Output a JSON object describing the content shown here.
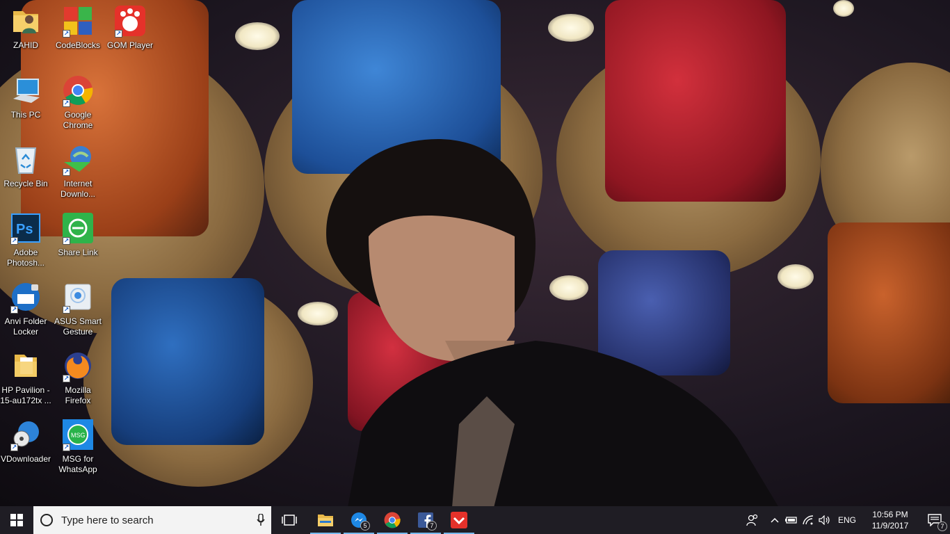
{
  "desktop": {
    "icons": [
      {
        "label": "ZAHID",
        "icon": "user-folder-icon"
      },
      {
        "label": "CodeBlocks",
        "icon": "codeblocks-icon"
      },
      {
        "label": "GOM Player",
        "icon": "gom-player-icon"
      },
      {
        "label": "This PC",
        "icon": "computer-icon"
      },
      {
        "label": "Google Chrome",
        "icon": "chrome-icon"
      },
      {
        "label": "Recycle Bin",
        "icon": "recycle-bin-icon"
      },
      {
        "label": "Internet Downlo...",
        "icon": "idm-icon"
      },
      {
        "label": "Adobe Photosh...",
        "icon": "photoshop-icon"
      },
      {
        "label": "Share Link",
        "icon": "share-link-icon"
      },
      {
        "label": "Anvi Folder Locker",
        "icon": "folder-locker-icon"
      },
      {
        "label": "ASUS Smart Gesture",
        "icon": "smart-gesture-icon"
      },
      {
        "label": "HP Pavilion - 15-au172tx ...",
        "icon": "folder-icon"
      },
      {
        "label": "Mozilla Firefox",
        "icon": "firefox-icon"
      },
      {
        "label": "VDownloader",
        "icon": "vdownloader-icon"
      },
      {
        "label": "MSG for WhatsApp",
        "icon": "msg-whatsapp-icon"
      }
    ]
  },
  "taskbar": {
    "search": {
      "placeholder": "Type here to search"
    },
    "apps": [
      {
        "name": "file-explorer",
        "icon": "folder-icon"
      },
      {
        "name": "messenger",
        "icon": "messenger-icon",
        "badge": "5"
      },
      {
        "name": "chrome",
        "icon": "chrome-icon"
      },
      {
        "name": "facebook",
        "icon": "facebook-icon",
        "badge": "7"
      },
      {
        "name": "gom",
        "icon": "gom-icon"
      }
    ],
    "tray": {
      "language": "ENG",
      "time": "10:56 PM",
      "date": "11/9/2017",
      "notification_count": "7"
    }
  }
}
